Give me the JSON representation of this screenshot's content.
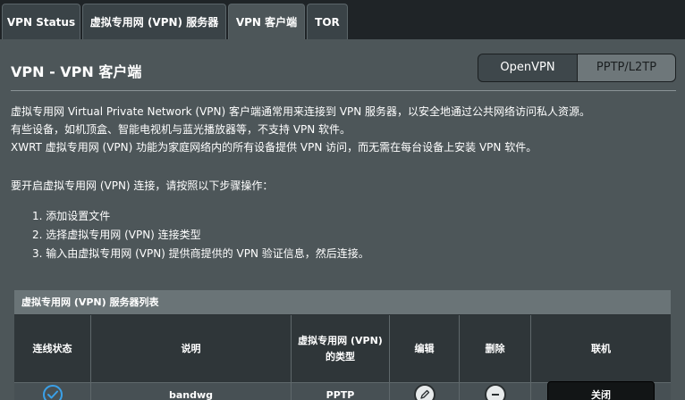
{
  "tabs": [
    {
      "label": "VPN Status"
    },
    {
      "label": "虚拟专用网 (VPN) 服务器"
    },
    {
      "label": "VPN 客户端"
    },
    {
      "label": "TOR"
    }
  ],
  "active_tab": "VPN 客户端",
  "page": {
    "title": "VPN - VPN 客户端",
    "mode_toggle": {
      "openvpn": "OpenVPN",
      "pptp": "PPTP/L2TP",
      "selected": "PPTP/L2TP"
    }
  },
  "description": {
    "line1": "虚拟专用网 Virtual Private Network (VPN) 客户端通常用来连接到 VPN 服务器，以安全地通过公共网络访问私人资源。",
    "line2": "有些设备，如机顶盒、智能电视机与蓝光播放器等，不支持 VPN 软件。",
    "line3": "XWRT 虚拟专用网 (VPN) 功能为家庭网络内的所有设备提供 VPN 访问，而无需在每台设备上安装 VPN 软件。",
    "steps_intro": "要开启虚拟专用网 (VPN) 连接，请按照以下步骤操作：",
    "steps": [
      "1. 添加设置文件",
      "2. 选择虚拟专用网 (VPN) 连接类型",
      "3. 输入由虚拟专用网 (VPN) 提供商提供的 VPN 验证信息，然后连接。"
    ]
  },
  "server_list": {
    "title": "虚拟专用网 (VPN) 服务器列表",
    "columns": {
      "status": "连线状态",
      "description": "说明",
      "type_line1": "虚拟专用网 (VPN)",
      "type_line2": "的类型",
      "edit": "编辑",
      "delete": "删除",
      "connect": "联机"
    },
    "rows": [
      {
        "status_icon": "check-circle-icon",
        "description": "bandwg",
        "type": "PPTP",
        "edit_icon": "pencil-icon",
        "delete_icon": "minus-circle-icon",
        "connect_label": "关闭"
      }
    ]
  },
  "colors": {
    "accent_check": "#3aa0e8",
    "background": "#4d5659",
    "tab_bar": "#1f2427"
  }
}
